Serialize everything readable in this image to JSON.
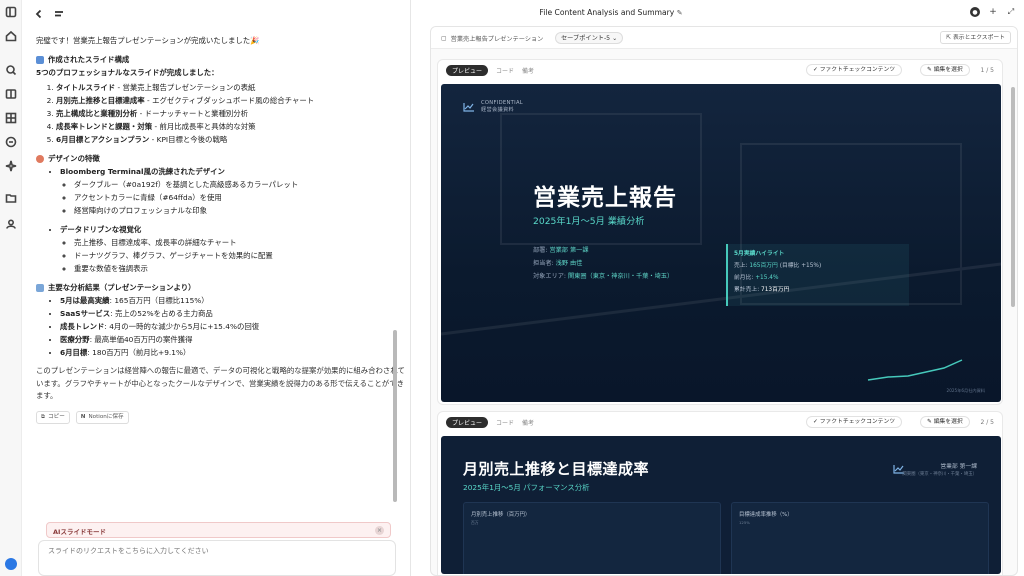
{
  "chat": {
    "intro": "完璧です！営業売上報告プレゼンテーションが完成いたしました🎉",
    "section1_heading": "作成されたスライド構成",
    "section1_lead": "5つのプロフェッショナルなスライドが完成しました：",
    "slides": [
      {
        "name": "タイトルスライド",
        "desc": " - 営業売上報告プレゼンテーションの表紙"
      },
      {
        "name": "月別売上推移と目標達成率",
        "desc": " - エグゼクティブダッシュボード風の総合チャート"
      },
      {
        "name": "売上構成比と業種別分析",
        "desc": " - ドーナッチャートと業種別分析"
      },
      {
        "name": "成長率トレンドと課題・対策",
        "desc": " - 前月比成長率と具体的な対策"
      },
      {
        "name": "6月目標とアクションプラン",
        "desc": " - KPI目標と今後の戦略"
      }
    ],
    "section2_heading": "デザインの特徴",
    "design_group1_title": "Bloomberg Terminal風の洗練されたデザイン",
    "design_group1_items": [
      "ダークブルー（#0a192f）を基調とした高級感あるカラーパレット",
      "アクセントカラーに青緑（#64ffda）を使用",
      "経営陣向けのプロフェッショナルな印象"
    ],
    "design_group2_title": "データドリブンな視覚化",
    "design_group2_items": [
      "売上推移、目標達成率、成長率の詳細なチャート",
      "ドーナツグラフ、棒グラフ、ゲージチャートを効果的に配置",
      "重要な数値を強調表示"
    ],
    "section3_heading": "主要な分析結果（プレゼンテーションより）",
    "results": [
      {
        "label": "5月は最高実績",
        "desc": ": 165百万円（目標比115%）"
      },
      {
        "label": "SaaSサービス",
        "desc": ": 売上の52%を占める主力商品"
      },
      {
        "label": "成長トレンド",
        "desc": ": 4月の一時的な減少から5月に+15.4%の回復"
      },
      {
        "label": "医療分野",
        "desc": ": 最高単価40百万円の案件獲得"
      },
      {
        "label": "6月目標",
        "desc": ": 180百万円（前月比+9.1%）"
      }
    ],
    "closing": "このプレゼンテーションは経営陣への報告に最適で、データの可視化と戦略的な提案が効果的に組み合わされています。グラフやチャートが中心となったクールなデザインで、営業実績を説得力のある形で伝えることができます。",
    "copy_label": "コピー",
    "notion_label": "Notionに保存",
    "ai_mode_label": "AIスライドモード",
    "input_placeholder": "スライドのリクエストをこちらに入力してください"
  },
  "header": {
    "title": "File Content Analysis and Summary"
  },
  "preview": {
    "file_name": "営業売上報告プレゼンテーション",
    "checkpoint": "セーブポイント-5",
    "export_label": "表示とエクスポート",
    "tab_preview": "プレビュー",
    "tab_code": "コード",
    "tab_memo": "備考",
    "factcheck_label": "ファクトチェックコンテンツ",
    "select_edit_label": "編集を選択",
    "page1": "1 / 5",
    "page2": "2 / 5"
  },
  "slide1": {
    "conf_line1": "CONFIDENTIAL",
    "conf_line2": "経営会議資料",
    "title": "営業売上報告",
    "subtitle": "2025年1月～5月 業績分析",
    "dept_label": "部署:",
    "dept_value": "営業部 第一課",
    "owner_label": "担当者:",
    "owner_value": "浅野 由佳",
    "area_label": "対象エリア:",
    "area_value": "関東圏（東京・神奈川・千葉・埼玉）",
    "highlight_title": "5月実績ハイライト",
    "hl_sales_label": "売上:",
    "hl_sales_value": "165百万円",
    "hl_sales_note": "(目標比 +15%)",
    "hl_mom_label": "前月比:",
    "hl_mom_value": "+15.4%",
    "hl_total_label": "累計売上:",
    "hl_total_value": "713百万円",
    "footer": "2025年6月社内資料"
  },
  "slide2": {
    "title": "月別売上推移と目標達成率",
    "subtitle": "2025年1月～5月 パフォーマンス分析",
    "dept": "営業部 第一課",
    "area": "関東圏（東京・神奈川・千葉・埼玉）",
    "panel1_title": "月別売上推移（百万円）",
    "panel1_unit": "百万",
    "panel2_title": "目標達成率推移（%）",
    "panel2_unit": "125%"
  },
  "colors": {
    "slide_bg": "#0d1d33",
    "accent": "#59d8c9"
  }
}
